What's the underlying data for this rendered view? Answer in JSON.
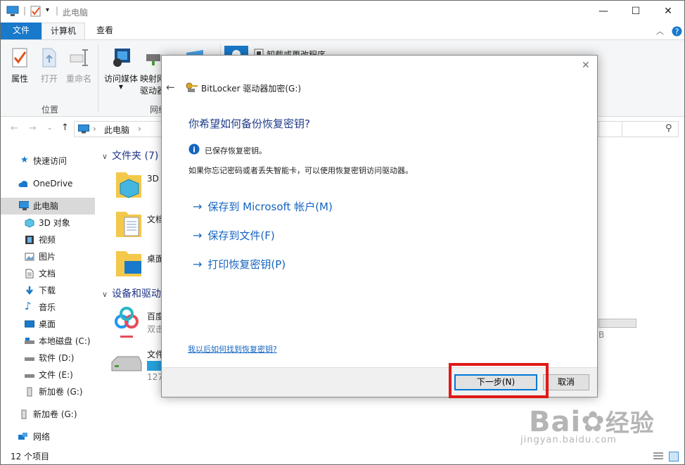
{
  "titlebar": {
    "title": "此电脑",
    "minimize": "—",
    "maximize": "☐",
    "close": "✕"
  },
  "ribbon_tabs": [
    "文件",
    "计算机",
    "查看"
  ],
  "ribbon": {
    "items": {
      "properties": "属性",
      "open": "打开",
      "rename": "重命名",
      "access_media": "访问媒体",
      "map_drive_line1": "映射网",
      "map_drive_line2": "驱动器",
      "uninstall": "卸载或更改程序"
    },
    "groups": {
      "location": "位置",
      "network": "网络"
    }
  },
  "address": {
    "path": "此电脑",
    "back": "←",
    "forward": "→",
    "up": "↑"
  },
  "nav": {
    "quick_access": "快速访问",
    "onedrive": "OneDrive",
    "this_pc": "此电脑",
    "objects_3d": "3D 对象",
    "videos": "视频",
    "pictures": "图片",
    "documents": "文档",
    "downloads": "下载",
    "music": "音乐",
    "desktop": "桌面",
    "local_c": "本地磁盘 (C:)",
    "soft_d": "软件 (D:)",
    "file_e": "文件 (E:)",
    "new_g": "新加卷 (G:)",
    "new_g2": "新加卷 (G:)",
    "network": "网络"
  },
  "content": {
    "folders_header": "文件夹 (7)",
    "folder_3d": "3D",
    "folder_doc": "文档",
    "folder_desktop": "桌面",
    "devices_header": "设备和驱动",
    "baidu_name": "百度",
    "baidu_sub": "双击",
    "file_drive": "文件",
    "file_drive_size": "127",
    "right_size_fragment": "B",
    "drive_fill_fraction": 0.0
  },
  "status": {
    "items": "12 个项目"
  },
  "dialog": {
    "title": "BitLocker 驱动器加密(G:)",
    "heading": "你希望如何备份恢复密钥?",
    "info": "已保存恢复密钥。",
    "desc": "如果你忘记密码或者丢失智能卡，可以使用恢复密钥访问驱动器。",
    "options": [
      "保存到 Microsoft 帐户(M)",
      "保存到文件(F)",
      "打印恢复密钥(P)"
    ],
    "help_link": "我以后如何找到恢复密钥?",
    "next": "下一步(N)",
    "cancel": "取消",
    "close": "✕",
    "back": "←"
  },
  "watermark": {
    "brand": "Bai",
    "brand2": "经验",
    "url": "jingyan.baidu.com"
  },
  "colors": {
    "accent": "#1979ca",
    "link": "#1565c0",
    "highlight": "#e01818"
  }
}
